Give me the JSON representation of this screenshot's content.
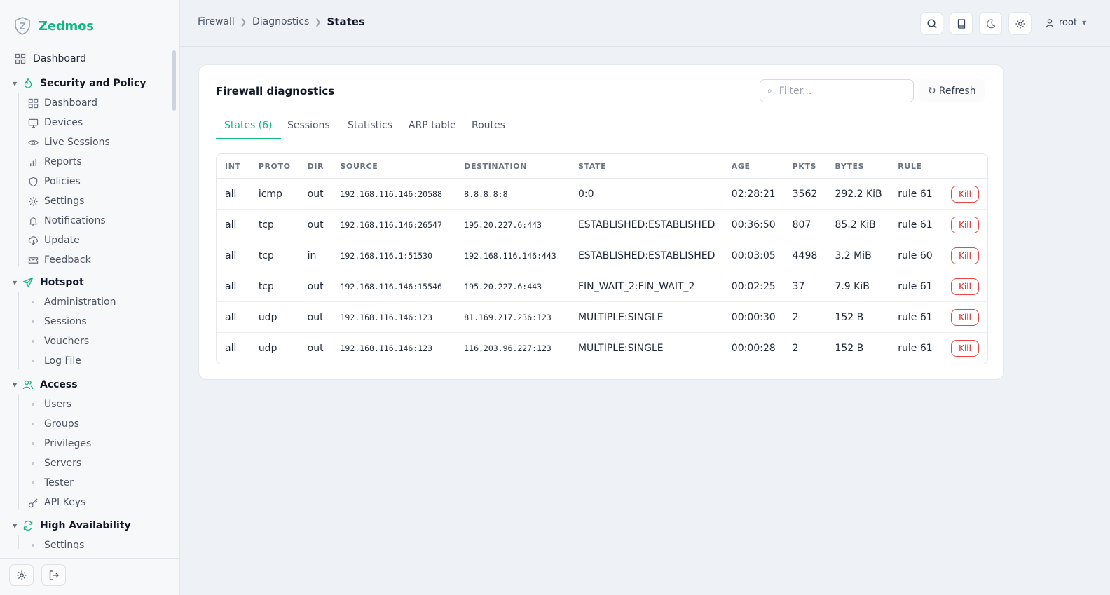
{
  "brand": {
    "name": "Zedmos"
  },
  "sidebar": {
    "dashboard": "Dashboard",
    "sections": [
      {
        "title": "Security and Policy",
        "icon": "flame-icon",
        "items": [
          {
            "label": "Dashboard",
            "icon": "grid-icon"
          },
          {
            "label": "Devices",
            "icon": "monitor-icon"
          },
          {
            "label": "Live Sessions",
            "icon": "eye-icon"
          },
          {
            "label": "Reports",
            "icon": "bar-chart-icon"
          },
          {
            "label": "Policies",
            "icon": "shield-icon"
          },
          {
            "label": "Settings",
            "icon": "gear-icon"
          },
          {
            "label": "Notifications",
            "icon": "bell-icon"
          },
          {
            "label": "Update",
            "icon": "download-icon"
          },
          {
            "label": "Feedback",
            "icon": "ticket-icon"
          }
        ]
      },
      {
        "title": "Hotspot",
        "icon": "send-icon",
        "items": [
          {
            "label": "Administration"
          },
          {
            "label": "Sessions"
          },
          {
            "label": "Vouchers"
          },
          {
            "label": "Log File"
          }
        ]
      },
      {
        "title": "Access",
        "icon": "users-icon",
        "items": [
          {
            "label": "Users"
          },
          {
            "label": "Groups"
          },
          {
            "label": "Privileges"
          },
          {
            "label": "Servers"
          },
          {
            "label": "Tester"
          },
          {
            "label": "API Keys",
            "icon": "key-icon"
          }
        ]
      },
      {
        "title": "High Availability",
        "icon": "refresh-icon",
        "items": [
          {
            "label": "Settings"
          }
        ]
      }
    ]
  },
  "breadcrumb": {
    "items": [
      "Firewall",
      "Diagnostics"
    ],
    "current": "States"
  },
  "header": {
    "user": "root"
  },
  "card": {
    "title": "Firewall diagnostics",
    "filter_placeholder": "Filter...",
    "refresh_label": "Refresh",
    "tabs": [
      "States (6)",
      "Sessions",
      "Statistics",
      "ARP table",
      "Routes"
    ],
    "columns": [
      "INT",
      "PROTO",
      "DIR",
      "SOURCE",
      "DESTINATION",
      "STATE",
      "AGE",
      "PKTS",
      "BYTES",
      "RULE"
    ],
    "kill_label": "Kill",
    "rows": [
      {
        "int": "all",
        "proto": "icmp",
        "dir": "out",
        "source": "192.168.116.146:20588",
        "destination": "8.8.8.8:8",
        "state": "0:0",
        "age": "02:28:21",
        "pkts": "3562",
        "bytes": "292.2 KiB",
        "rule": "rule 61"
      },
      {
        "int": "all",
        "proto": "tcp",
        "dir": "out",
        "source": "192.168.116.146:26547",
        "destination": "195.20.227.6:443",
        "state": "ESTABLISHED:ESTABLISHED",
        "age": "00:36:50",
        "pkts": "807",
        "bytes": "85.2 KiB",
        "rule": "rule 61"
      },
      {
        "int": "all",
        "proto": "tcp",
        "dir": "in",
        "source": "192.168.116.1:51530",
        "destination": "192.168.116.146:443",
        "state": "ESTABLISHED:ESTABLISHED",
        "age": "00:03:05",
        "pkts": "4498",
        "bytes": "3.2 MiB",
        "rule": "rule 60"
      },
      {
        "int": "all",
        "proto": "tcp",
        "dir": "out",
        "source": "192.168.116.146:15546",
        "destination": "195.20.227.6:443",
        "state": "FIN_WAIT_2:FIN_WAIT_2",
        "age": "00:02:25",
        "pkts": "37",
        "bytes": "7.9 KiB",
        "rule": "rule 61"
      },
      {
        "int": "all",
        "proto": "udp",
        "dir": "out",
        "source": "192.168.116.146:123",
        "destination": "81.169.217.236:123",
        "state": "MULTIPLE:SINGLE",
        "age": "00:00:30",
        "pkts": "2",
        "bytes": "152 B",
        "rule": "rule 61"
      },
      {
        "int": "all",
        "proto": "udp",
        "dir": "out",
        "source": "192.168.116.146:123",
        "destination": "116.203.96.227:123",
        "state": "MULTIPLE:SINGLE",
        "age": "00:00:28",
        "pkts": "2",
        "bytes": "152 B",
        "rule": "rule 61"
      }
    ]
  },
  "colors": {
    "accent": "#10b981",
    "danger": "#dc2626"
  }
}
